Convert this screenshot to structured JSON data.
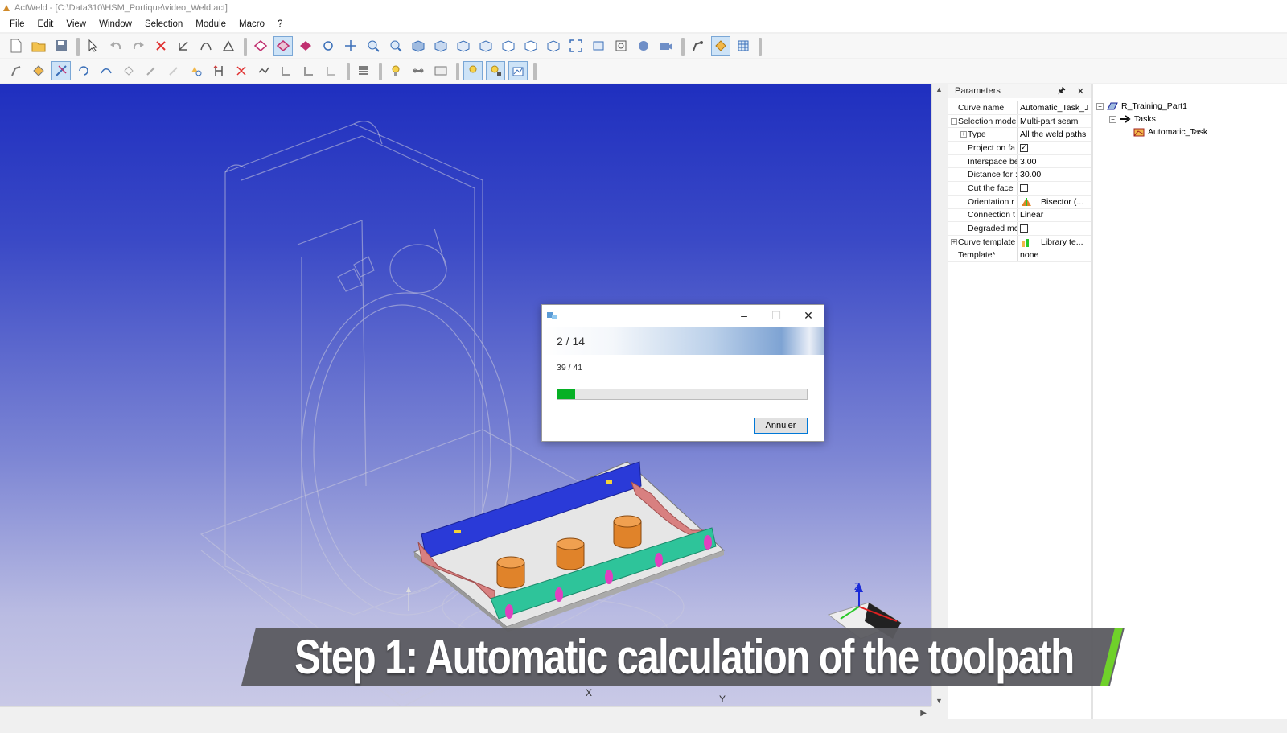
{
  "window": {
    "title": "ActWeld - [C:\\Data310\\HSM_Portique\\video_Weld.act]"
  },
  "menu": [
    "File",
    "Edit",
    "View",
    "Window",
    "Selection",
    "Module",
    "Macro",
    "?"
  ],
  "parameters_panel": {
    "title": "Parameters",
    "rows": [
      {
        "name": "Curve name",
        "value": "Automatic_Task_J"
      },
      {
        "name": "Selection mode",
        "value": "Multi-part seam"
      },
      {
        "name": "Type",
        "value": "All the weld paths"
      },
      {
        "name": "Project on fa",
        "value": ""
      },
      {
        "name": "Interspace be",
        "value": "3.00"
      },
      {
        "name": "Distance for :",
        "value": "30.00"
      },
      {
        "name": "Cut the face",
        "value": ""
      },
      {
        "name": "Orientation r",
        "value": "Bisector (..."
      },
      {
        "name": "Connection t",
        "value": "Linear"
      },
      {
        "name": "Degraded mc",
        "value": ""
      },
      {
        "name": "Curve template",
        "value": "Library te..."
      },
      {
        "name": "Template*",
        "value": "none"
      }
    ]
  },
  "tree": {
    "root": "R_Training_Part1",
    "tasks": "Tasks",
    "task": "Automatic_Task"
  },
  "dialog": {
    "step": "2 / 14",
    "count": "39 / 41",
    "progress": 0.07,
    "cancel_label": "Annuler"
  },
  "caption": {
    "text": "Step 1: Automatic calculation of the toolpath"
  },
  "axes": {
    "x": "X",
    "y": "Y",
    "z": "Z"
  },
  "colors": {
    "viewport_top": "#1f2fbf",
    "viewport_bottom": "#c9c9e6",
    "progress": "#06b025",
    "caption_accent": "#6fd12a"
  }
}
